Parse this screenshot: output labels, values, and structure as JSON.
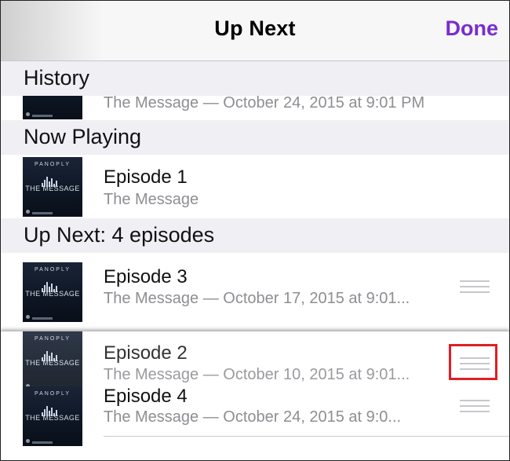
{
  "navbar": {
    "title": "Up Next",
    "done_label": "Done"
  },
  "sections": {
    "history": "History",
    "now_playing": "Now Playing",
    "up_next": "Up Next: 4 episodes"
  },
  "thumbnail": {
    "brand": "PANOPLY",
    "label": "THE MESSAGE"
  },
  "history_row": {
    "subtitle": "The Message — October 24, 2015 at 9:01 PM"
  },
  "now_playing_row": {
    "title": "Episode 1",
    "subtitle": "The Message"
  },
  "up_next_rows": [
    {
      "title": "Episode 3",
      "subtitle": "The Message — October 17, 2015 at 9:01..."
    },
    {
      "title": "Episode 2",
      "subtitle": "The Message — October 10, 2015 at 9:01..."
    },
    {
      "title": "Episode 4",
      "subtitle": "The Message — October 24, 2015 at 9:0..."
    }
  ],
  "colors": {
    "accent": "#7a2ccf",
    "highlight": "#e01e26",
    "section_bg": "#efeff4"
  }
}
